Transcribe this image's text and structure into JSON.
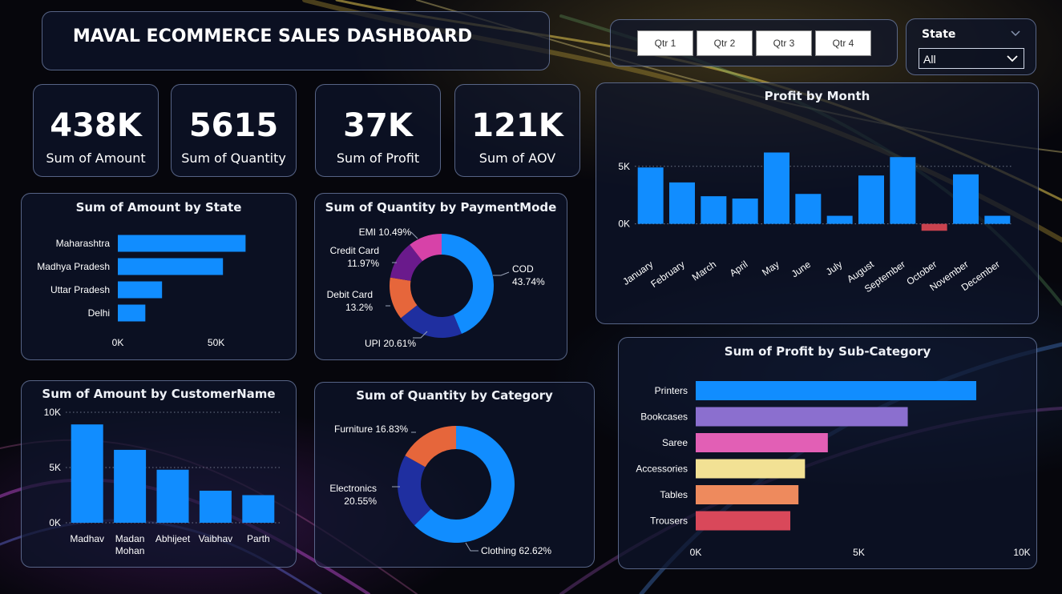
{
  "header": {
    "title": "MAVAL ECOMMERCE SALES DASHBOARD"
  },
  "quarter_slicer": {
    "buttons": [
      "Qtr 1",
      "Qtr 2",
      "Qtr 3",
      "Qtr 4"
    ]
  },
  "state_slicer": {
    "label": "State",
    "selected": "All"
  },
  "kpis": [
    {
      "value": "438K",
      "label": "Sum of Amount"
    },
    {
      "value": "5615",
      "label": "Sum of Quantity"
    },
    {
      "value": "37K",
      "label": "Sum of Profit"
    },
    {
      "value": "121K",
      "label": "Sum of AOV"
    }
  ],
  "colors": {
    "accent": "#118dff",
    "negative": "#c9424e",
    "donut_dark": "#1f2fa0",
    "donut_orange": "#e6663b",
    "donut_purple": "#6a1a8c",
    "donut_pink": "#d742a8"
  },
  "chart_data": [
    {
      "id": "amount-by-state",
      "type": "bar",
      "orientation": "horizontal",
      "title": "Sum of Amount by State",
      "categories": [
        "Maharashtra",
        "Madhya Pradesh",
        "Uttar Pradesh",
        "Delhi"
      ],
      "values": [
        65000,
        53500,
        22500,
        14000
      ],
      "xlim": [
        0,
        73000
      ],
      "ticks": [
        {
          "value": 0,
          "label": "0K"
        },
        {
          "value": 50000,
          "label": "50K"
        }
      ]
    },
    {
      "id": "quantity-by-paymentmode",
      "type": "pie",
      "donut": true,
      "title": "Sum of Quantity by PaymentMode",
      "slices": [
        {
          "name": "COD",
          "pct": 43.74,
          "label": "COD 43.74%",
          "color": "#118dff"
        },
        {
          "name": "UPI",
          "pct": 20.61,
          "label": "UPI 20.61%",
          "color": "#1f2fa0"
        },
        {
          "name": "Debit Card",
          "pct": 13.2,
          "label": "Debit Card 13.2%",
          "color": "#e6663b"
        },
        {
          "name": "Credit Card",
          "pct": 11.97,
          "label": "Credit Card 11.97%",
          "color": "#6a1a8c"
        },
        {
          "name": "EMI",
          "pct": 10.49,
          "label": "EMI 10.49%",
          "color": "#d742a8"
        }
      ]
    },
    {
      "id": "profit-by-month",
      "type": "bar",
      "title": "Profit by Month",
      "categories": [
        "January",
        "February",
        "March",
        "April",
        "May",
        "June",
        "July",
        "August",
        "September",
        "October",
        "November",
        "December"
      ],
      "values": [
        4900,
        3600,
        2400,
        2200,
        6200,
        2600,
        700,
        4200,
        5800,
        -600,
        4300,
        700
      ],
      "ylim": [
        -1000,
        7000
      ],
      "ticks": [
        {
          "value": 0,
          "label": "0K"
        },
        {
          "value": 5000,
          "label": "5K"
        }
      ]
    },
    {
      "id": "amount-by-customername",
      "type": "bar",
      "title": "Sum of Amount by CustomerName",
      "categories": [
        "Madhav",
        "Madan Mohan",
        "Abhijeet",
        "Vaibhav",
        "Parth"
      ],
      "values": [
        8900,
        6600,
        4800,
        2900,
        2500
      ],
      "ylim": [
        0,
        10000
      ],
      "ticks": [
        {
          "value": 0,
          "label": "0K"
        },
        {
          "value": 5000,
          "label": "5K"
        },
        {
          "value": 10000,
          "label": "10K"
        }
      ]
    },
    {
      "id": "quantity-by-category",
      "type": "pie",
      "donut": true,
      "title": "Sum of Quantity by Category",
      "slices": [
        {
          "name": "Clothing",
          "pct": 62.62,
          "label": "Clothing 62.62%",
          "color": "#118dff"
        },
        {
          "name": "Electronics",
          "pct": 20.55,
          "label": "Electronics 20.55%",
          "color": "#1f2fa0"
        },
        {
          "name": "Furniture",
          "pct": 16.83,
          "label": "Furniture 16.83%",
          "color": "#e6663b"
        }
      ]
    },
    {
      "id": "profit-by-subcategory",
      "type": "bar",
      "orientation": "horizontal",
      "title": "Sum of Profit by Sub-Category",
      "categories": [
        "Printers",
        "Bookcases",
        "Saree",
        "Accessories",
        "Tables",
        "Trousers"
      ],
      "values": [
        8600,
        6500,
        4050,
        3350,
        3150,
        2900
      ],
      "colors": [
        "#118dff",
        "#8b6fcf",
        "#e25fb5",
        "#f2e194",
        "#ee8a5d",
        "#d9485a"
      ],
      "xlim": [
        0,
        10000
      ],
      "ticks": [
        {
          "value": 0,
          "label": "0K"
        },
        {
          "value": 5000,
          "label": "5K"
        },
        {
          "value": 10000,
          "label": "10K"
        }
      ]
    }
  ]
}
